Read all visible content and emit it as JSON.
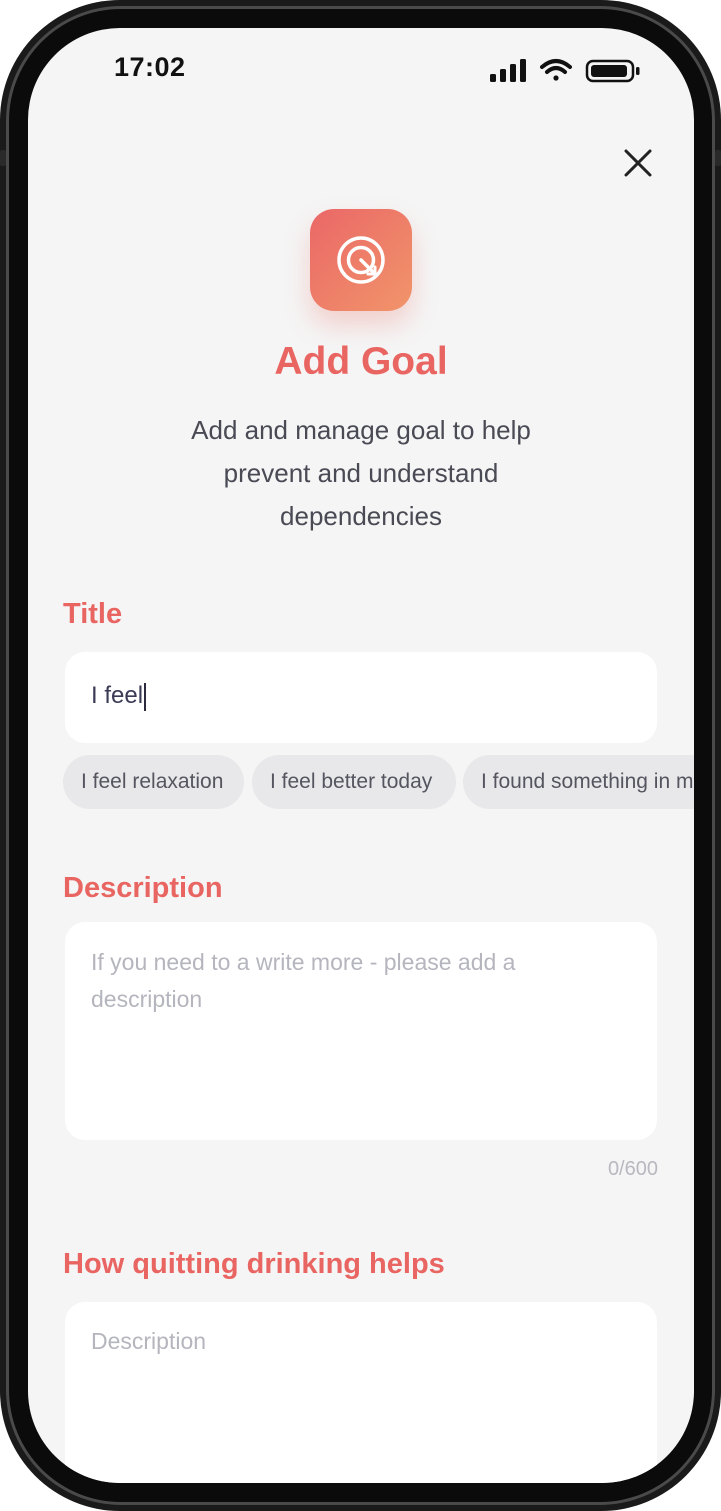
{
  "status_bar": {
    "time": "17:02"
  },
  "header": {
    "title": "Add Goal",
    "subtitle": "Add and manage goal to help prevent and understand dependencies"
  },
  "title_field": {
    "label": "Title",
    "value": "I feel",
    "suggestions": [
      "I feel relaxation",
      "I feel better today",
      "I found something in m"
    ]
  },
  "description_field": {
    "label": "Description",
    "placeholder": "If you need to a write more - please add a description",
    "counter": "0/600"
  },
  "benefit_field": {
    "label": "How quitting drinking helps",
    "placeholder": "Description"
  },
  "icons": {
    "close": "close-icon",
    "app": "target-icon",
    "signal": "signal-icon",
    "wifi": "wifi-icon",
    "battery": "battery-icon"
  },
  "colors": {
    "accent": "#e96562",
    "gradient_start": "#ea6767",
    "gradient_end": "#f1956a",
    "screen_bg": "#f5f5f5"
  }
}
